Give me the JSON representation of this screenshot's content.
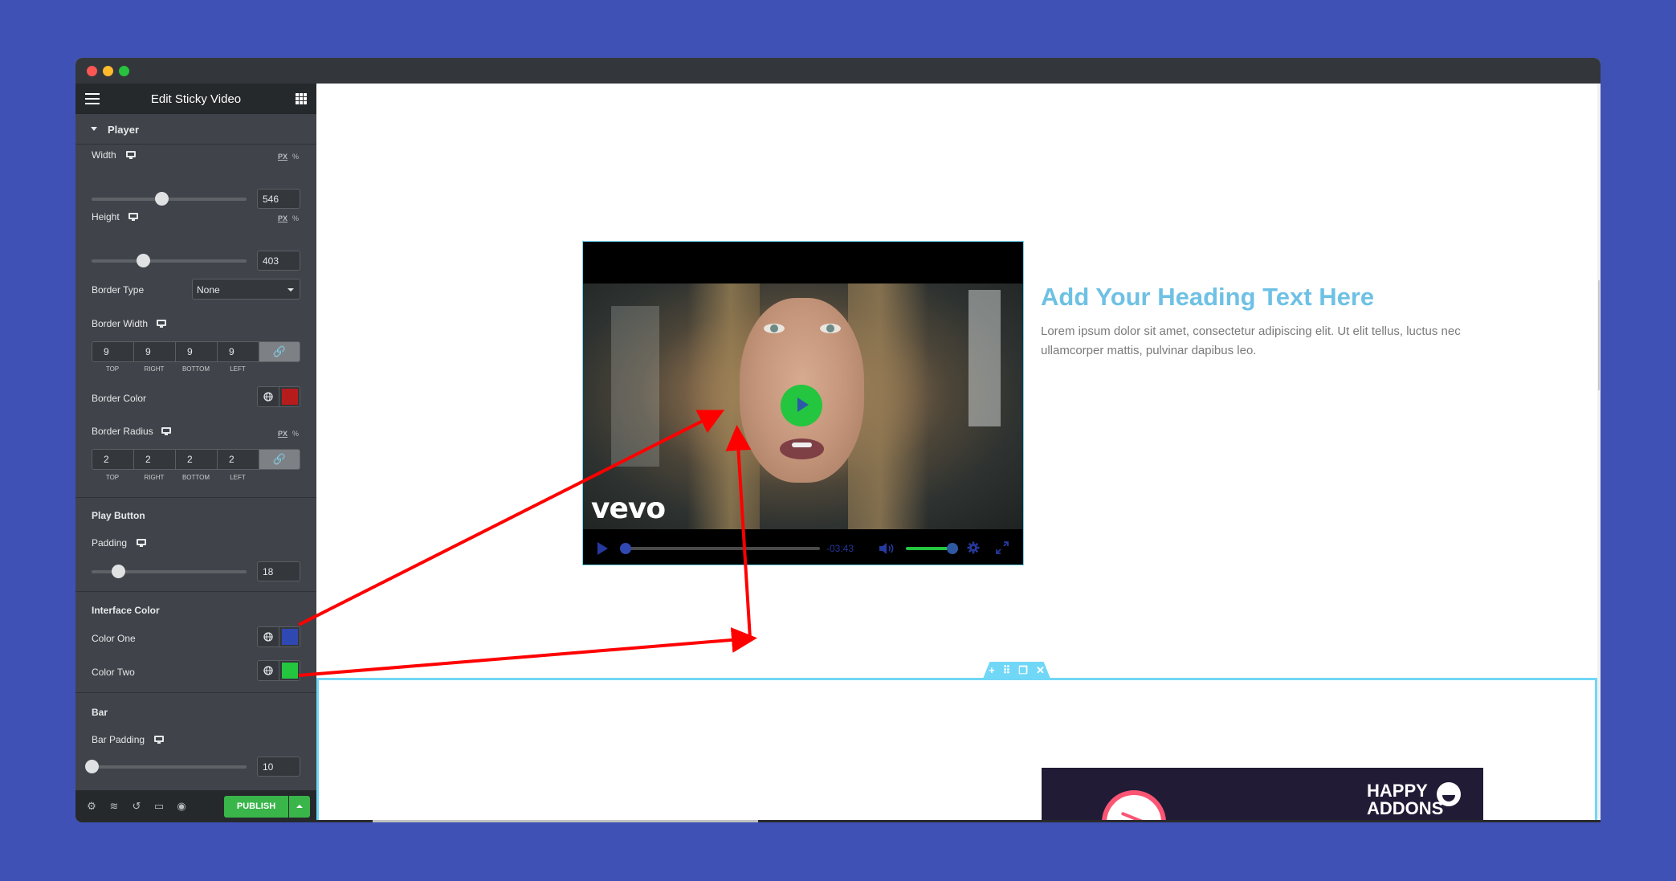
{
  "window": {
    "traffic_lights": [
      "close",
      "minimize",
      "maximize"
    ]
  },
  "sidebar": {
    "title": "Edit Sticky Video",
    "menu_icon": "hamburger-icon",
    "widgets_icon": "grid-icon",
    "section": "Player",
    "width": {
      "label": "Width",
      "unit_selected": "PX",
      "unit_alt": "%",
      "value": "546",
      "slider_fraction": 0.45
    },
    "height": {
      "label": "Height",
      "unit_selected": "PX",
      "unit_alt": "%",
      "value": "403",
      "slider_fraction": 0.33
    },
    "border_type": {
      "label": "Border Type",
      "value": "None"
    },
    "border_width": {
      "label": "Border Width",
      "values": [
        "9",
        "9",
        "9",
        "9"
      ],
      "sides": [
        "TOP",
        "RIGHT",
        "BOTTOM",
        "LEFT"
      ]
    },
    "border_color": {
      "label": "Border Color",
      "color": "#b71c1c"
    },
    "border_radius": {
      "label": "Border Radius",
      "unit_selected": "PX",
      "unit_alt": "%",
      "values": [
        "2",
        "2",
        "2",
        "2"
      ],
      "sides": [
        "TOP",
        "RIGHT",
        "BOTTOM",
        "LEFT"
      ]
    },
    "play_button": {
      "heading": "Play Button",
      "padding_label": "Padding",
      "value": "18",
      "slider_fraction": 0.17
    },
    "interface_color": {
      "heading": "Interface Color",
      "color_one": {
        "label": "Color One",
        "color": "#2f48b2"
      },
      "color_two": {
        "label": "Color Two",
        "color": "#24c53f"
      }
    },
    "bar": {
      "heading": "Bar",
      "padding_label": "Bar Padding",
      "value": "10",
      "slider_fraction": 0.0
    },
    "footer": {
      "icons": [
        "settings-icon",
        "layers-icon",
        "history-icon",
        "responsive-icon",
        "preview-icon"
      ],
      "publish_label": "PUBLISH"
    }
  },
  "canvas": {
    "video": {
      "watermark": "vevo",
      "time_remaining": "-03:43",
      "progress_fraction": 0.0,
      "volume_fraction": 1.0
    },
    "heading": "Add Your Heading Text Here",
    "paragraph": "Lorem ipsum dolor sit amet, consectetur adipiscing elit. Ut elit tellus, luctus nec ullamcorper mattis, pulvinar dapibus leo.",
    "section_handle": [
      "+",
      "⠿",
      "❐",
      "✕"
    ],
    "banner": {
      "logo_line1": "HAPPY",
      "logo_line2": "ADDONS"
    }
  },
  "annotations": {
    "arrow_color": "#ff0000",
    "description": "Red arrows from Color One swatch to the big play icon and from Color Two swatch to the play button circle"
  }
}
